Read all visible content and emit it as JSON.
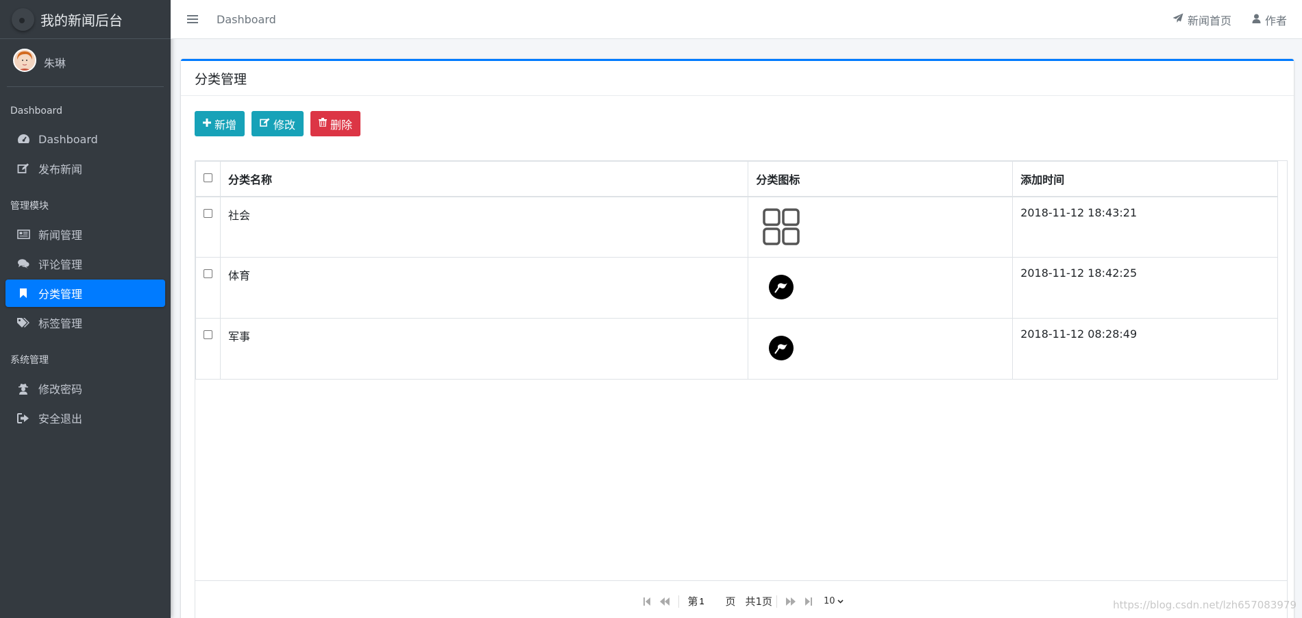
{
  "brand": {
    "title": "我的新闻后台"
  },
  "user": {
    "name": "朱琳"
  },
  "sidebar": {
    "sections": [
      {
        "header": "Dashboard",
        "items": [
          {
            "label": "Dashboard",
            "icon": "tachometer-icon"
          },
          {
            "label": "发布新闻",
            "icon": "edit-icon"
          }
        ]
      },
      {
        "header": "管理模块",
        "items": [
          {
            "label": "新闻管理",
            "icon": "newspaper-icon"
          },
          {
            "label": "评论管理",
            "icon": "comments-icon"
          },
          {
            "label": "分类管理",
            "icon": "bookmark-icon",
            "active": true
          },
          {
            "label": "标签管理",
            "icon": "tags-icon"
          }
        ]
      },
      {
        "header": "系统管理",
        "items": [
          {
            "label": "修改密码",
            "icon": "user-secret-icon"
          },
          {
            "label": "安全退出",
            "icon": "sign-out-icon"
          }
        ]
      }
    ]
  },
  "topbar": {
    "breadcrumb": "Dashboard",
    "links": [
      {
        "label": "新闻首页",
        "icon": "paper-plane-icon"
      },
      {
        "label": "作者",
        "icon": "user-icon"
      }
    ]
  },
  "card": {
    "title": "分类管理",
    "buttons": {
      "add": "新增",
      "edit": "修改",
      "delete": "删除"
    }
  },
  "table": {
    "headers": {
      "name": "分类名称",
      "icon": "分类图标",
      "time": "添加时间"
    },
    "rows": [
      {
        "name": "社会",
        "icon": "grid-icon",
        "time": "2018-11-12 18:43:21"
      },
      {
        "name": "体育",
        "icon": "flag-icon",
        "time": "2018-11-12 18:42:25"
      },
      {
        "name": "军事",
        "icon": "flag-icon",
        "time": "2018-11-12 08:28:49"
      }
    ]
  },
  "pager": {
    "page_prefix": "第",
    "page_value": "1",
    "page_suffix": "页",
    "total": "共1页",
    "page_size": "10"
  },
  "watermark": "https://blog.csdn.net/lzh657083979",
  "colors": {
    "primary": "#007bff",
    "info": "#17a2b8",
    "danger": "#dc3545",
    "sidebar": "#343a40"
  }
}
